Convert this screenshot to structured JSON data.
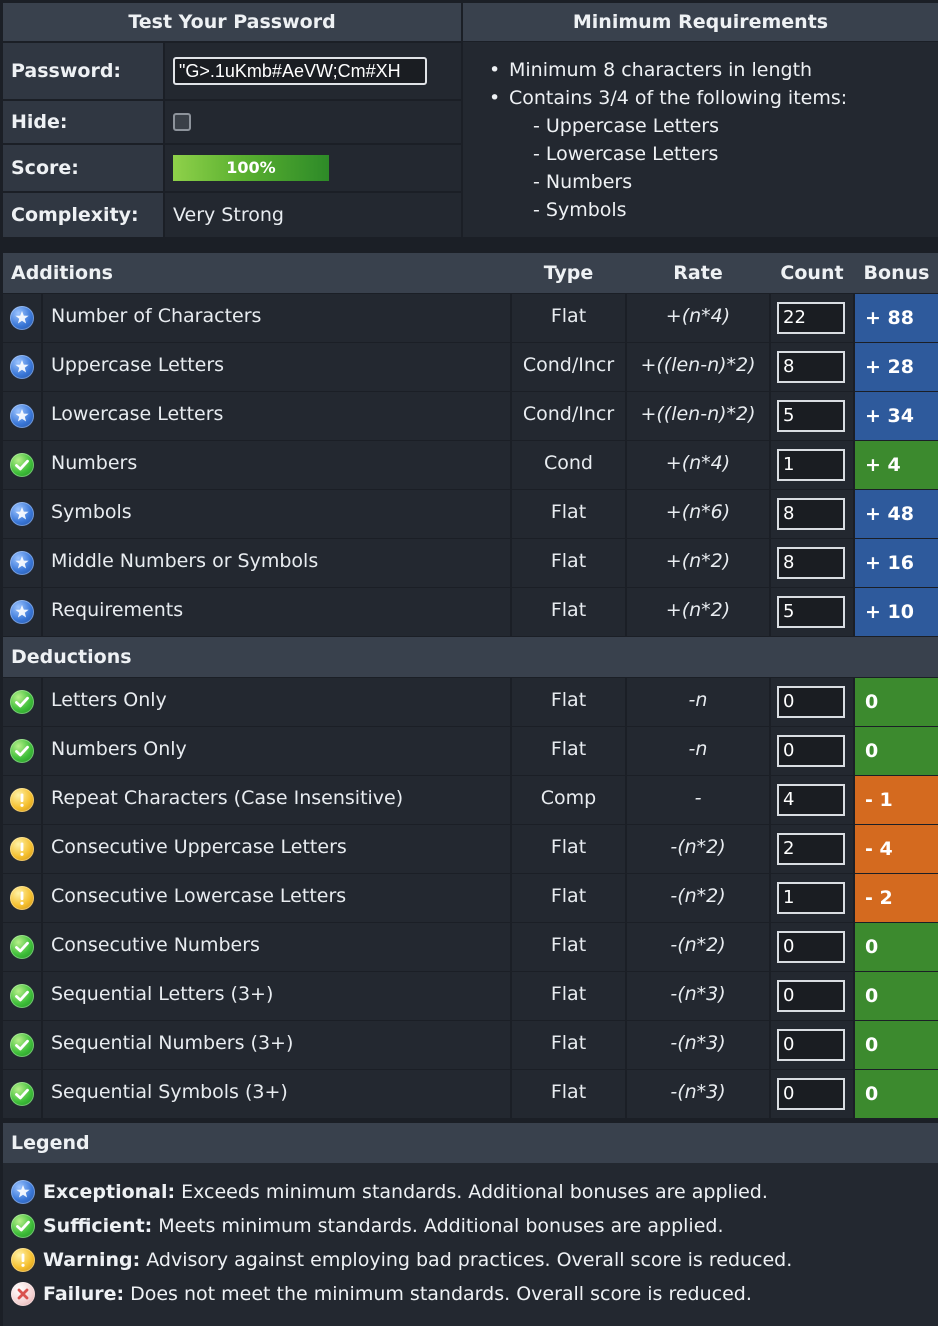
{
  "top": {
    "test_title": "Test Your Password",
    "req_title": "Minimum Requirements",
    "password_label": "Password:",
    "password_value": "\"G>.1uKmb#AeVW;Cm#XH",
    "hide_label": "Hide:",
    "score_label": "Score:",
    "score_value": "100%",
    "score_fraction": 1.0,
    "complexity_label": "Complexity:",
    "complexity_value": "Very Strong",
    "requirements": [
      "Minimum 8 characters in length",
      "Contains 3/4 of the following items:",
      "- Uppercase Letters",
      "- Lowercase Letters",
      "- Numbers",
      "- Symbols"
    ]
  },
  "columns": {
    "name": "Additions",
    "type": "Type",
    "rate": "Rate",
    "count": "Count",
    "bonus": "Bonus"
  },
  "additions": [
    {
      "status": "exceptional",
      "name": "Number of Characters",
      "type": "Flat",
      "rate": "+(n*4)",
      "count": "22",
      "bonus": "+ 88",
      "color": "blue"
    },
    {
      "status": "exceptional",
      "name": "Uppercase Letters",
      "type": "Cond/Incr",
      "rate": "+((len-n)*2)",
      "count": "8",
      "bonus": "+ 28",
      "color": "blue"
    },
    {
      "status": "exceptional",
      "name": "Lowercase Letters",
      "type": "Cond/Incr",
      "rate": "+((len-n)*2)",
      "count": "5",
      "bonus": "+ 34",
      "color": "blue"
    },
    {
      "status": "sufficient",
      "name": "Numbers",
      "type": "Cond",
      "rate": "+(n*4)",
      "count": "1",
      "bonus": "+ 4",
      "color": "green"
    },
    {
      "status": "exceptional",
      "name": "Symbols",
      "type": "Flat",
      "rate": "+(n*6)",
      "count": "8",
      "bonus": "+ 48",
      "color": "blue"
    },
    {
      "status": "exceptional",
      "name": "Middle Numbers or Symbols",
      "type": "Flat",
      "rate": "+(n*2)",
      "count": "8",
      "bonus": "+ 16",
      "color": "blue"
    },
    {
      "status": "exceptional",
      "name": "Requirements",
      "type": "Flat",
      "rate": "+(n*2)",
      "count": "5",
      "bonus": "+ 10",
      "color": "blue"
    }
  ],
  "deductions_title": "Deductions",
  "deductions": [
    {
      "status": "sufficient",
      "name": "Letters Only",
      "type": "Flat",
      "rate": "-n",
      "count": "0",
      "bonus": "0",
      "color": "green"
    },
    {
      "status": "sufficient",
      "name": "Numbers Only",
      "type": "Flat",
      "rate": "-n",
      "count": "0",
      "bonus": "0",
      "color": "green"
    },
    {
      "status": "warning",
      "name": "Repeat Characters (Case Insensitive)",
      "type": "Comp",
      "rate": "-",
      "count": "4",
      "bonus": "- 1",
      "color": "orange"
    },
    {
      "status": "warning",
      "name": "Consecutive Uppercase Letters",
      "type": "Flat",
      "rate": "-(n*2)",
      "count": "2",
      "bonus": "- 4",
      "color": "orange"
    },
    {
      "status": "warning",
      "name": "Consecutive Lowercase Letters",
      "type": "Flat",
      "rate": "-(n*2)",
      "count": "1",
      "bonus": "- 2",
      "color": "orange"
    },
    {
      "status": "sufficient",
      "name": "Consecutive Numbers",
      "type": "Flat",
      "rate": "-(n*2)",
      "count": "0",
      "bonus": "0",
      "color": "green"
    },
    {
      "status": "sufficient",
      "name": "Sequential Letters (3+)",
      "type": "Flat",
      "rate": "-(n*3)",
      "count": "0",
      "bonus": "0",
      "color": "green"
    },
    {
      "status": "sufficient",
      "name": "Sequential Numbers (3+)",
      "type": "Flat",
      "rate": "-(n*3)",
      "count": "0",
      "bonus": "0",
      "color": "green"
    },
    {
      "status": "sufficient",
      "name": "Sequential Symbols (3+)",
      "type": "Flat",
      "rate": "-(n*3)",
      "count": "0",
      "bonus": "0",
      "color": "green"
    }
  ],
  "legend": {
    "title": "Legend",
    "items": [
      {
        "status": "exceptional",
        "term": "Exceptional:",
        "text": "Exceeds minimum standards. Additional bonuses are applied."
      },
      {
        "status": "sufficient",
        "term": "Sufficient:",
        "text": "Meets minimum standards. Additional bonuses are applied."
      },
      {
        "status": "warning",
        "term": "Warning:",
        "text": "Advisory against employing bad practices. Overall score is reduced."
      },
      {
        "status": "failure",
        "term": "Failure:",
        "text": "Does not meet the minimum standards. Overall score is reduced."
      }
    ]
  },
  "icons": {
    "exceptional": "star-badge-icon",
    "sufficient": "check-circle-icon",
    "warning": "exclamation-circle-icon",
    "failure": "x-circle-icon"
  },
  "colors": {
    "blue": "#2e5a9c",
    "green": "#3c8a2e",
    "orange": "#d46a1f"
  }
}
